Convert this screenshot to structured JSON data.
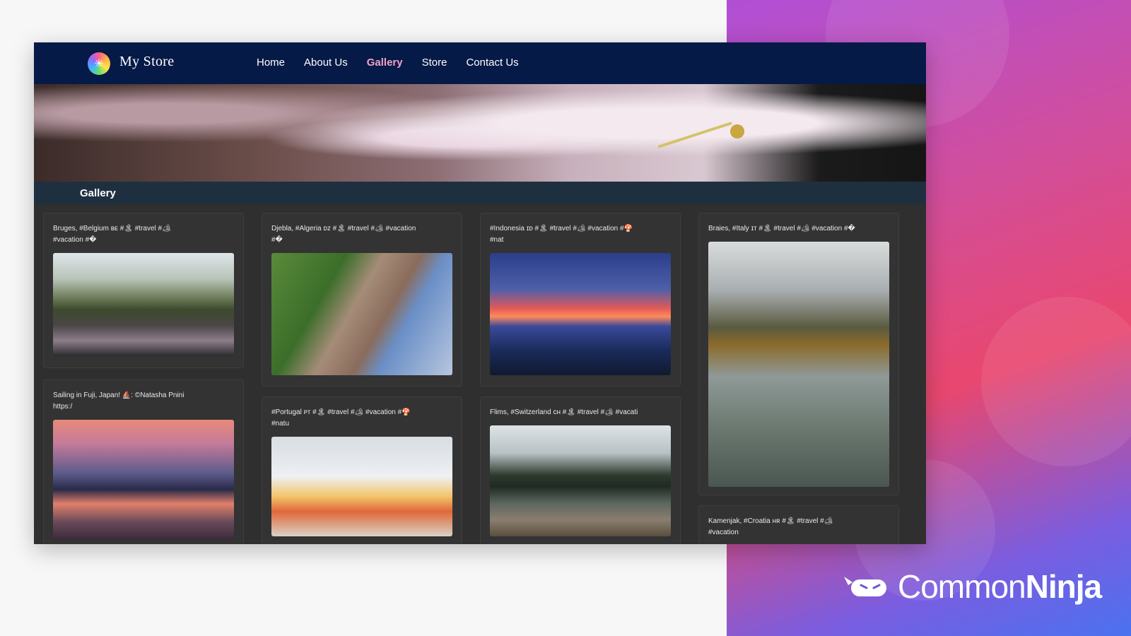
{
  "nav": {
    "logo_glyph": "✳",
    "store_name": "My Store",
    "links": [
      "Home",
      "About Us",
      "Gallery",
      "Store",
      "Contact Us"
    ],
    "active": "Gallery"
  },
  "section_title": "Gallery",
  "cards": [
    {
      "caption_line1": "Bruges, #Belgium ʙᴇ #🏝 #travel #🏕",
      "caption_line2": "#vacation #�"
    },
    {
      "caption_line1": "Djebla, #Algeria ᴅᴢ #🏝 #travel #🏕 #vacation",
      "caption_line2": "#�"
    },
    {
      "caption_line1": "#Indonesia ɪᴅ #🏝 #travel #🏕 #vacation #🍄",
      "caption_line2": "#nat"
    },
    {
      "caption_line1": "Braies, #Italy ɪᴛ #🏝 #travel #🏕 #vacation #�",
      "caption_line2": ""
    },
    {
      "caption_line1": "Sailing in Fuji, Japan! ⛵: ©Natasha Pnini",
      "caption_line2": "https:/"
    },
    {
      "caption_line1": "#Portugal ᴘᴛ #🏝 #travel #🏕 #vacation #🍄",
      "caption_line2": "#natu"
    },
    {
      "caption_line1": "Flims, #Switzerland ᴄʜ #🏝 #travel #🏕 #vacati",
      "caption_line2": ""
    },
    {
      "caption_line1": "Kamenjak, #Croatia ʜʀ #🏝 #travel #🏕",
      "caption_line2": "#vacation"
    }
  ],
  "brand": {
    "light": "Common",
    "bold": "Ninja"
  },
  "colors": {
    "nav_bg": "#061a47",
    "active_link": "#f2a2c6",
    "title_bar": "#1e3040",
    "card_bg": "#333333"
  }
}
